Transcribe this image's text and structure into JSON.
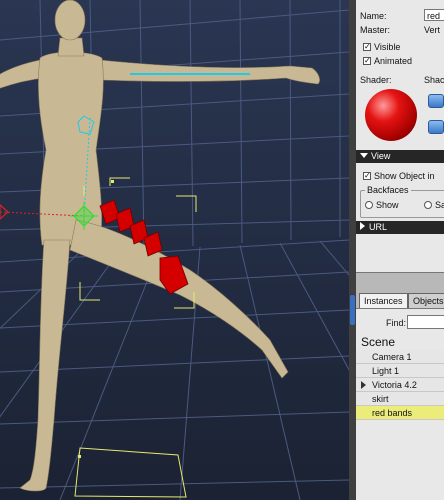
{
  "properties": {
    "name_label": "Name:",
    "name_value": "red",
    "master_label": "Master:",
    "master_value": "Vert",
    "visible_label": "Visible",
    "visible_checked": true,
    "animated_label": "Animated",
    "animated_checked": true,
    "shader_label": "Shader:",
    "shader_label_2": "Shac",
    "shader_color": "#e01010"
  },
  "view_section": {
    "title": "View",
    "show_object_label": "Show Object in",
    "show_object_checked": true,
    "backfaces_label": "Backfaces",
    "show_label": "Show",
    "second_option_label": "Sa"
  },
  "url_section": {
    "title": "URL"
  },
  "tabs": [
    {
      "label": "Instances",
      "active": true
    },
    {
      "label": "Objects",
      "active": false
    }
  ],
  "find_label": "Find:",
  "find_value": "",
  "scene_title": "Scene",
  "scene_items": [
    {
      "label": "Camera 1",
      "expandable": false,
      "selected": false
    },
    {
      "label": "Light 1",
      "expandable": false,
      "selected": false
    },
    {
      "label": "Victoria 4.2",
      "expandable": true,
      "selected": false
    },
    {
      "label": "skirt",
      "expandable": false,
      "selected": false
    },
    {
      "label": "red bands",
      "expandable": false,
      "selected": true
    }
  ],
  "colors": {
    "viewport_bg": "#1b2233",
    "grid_line": "#4a5a80",
    "figure_skin": "#c8b894",
    "band_red": "#d40000",
    "selection_yellow": "#ecec7a",
    "gizmo_green": "#33dd33",
    "gizmo_red": "#dd2222",
    "gizmo_cyan": "#22c8e8"
  }
}
